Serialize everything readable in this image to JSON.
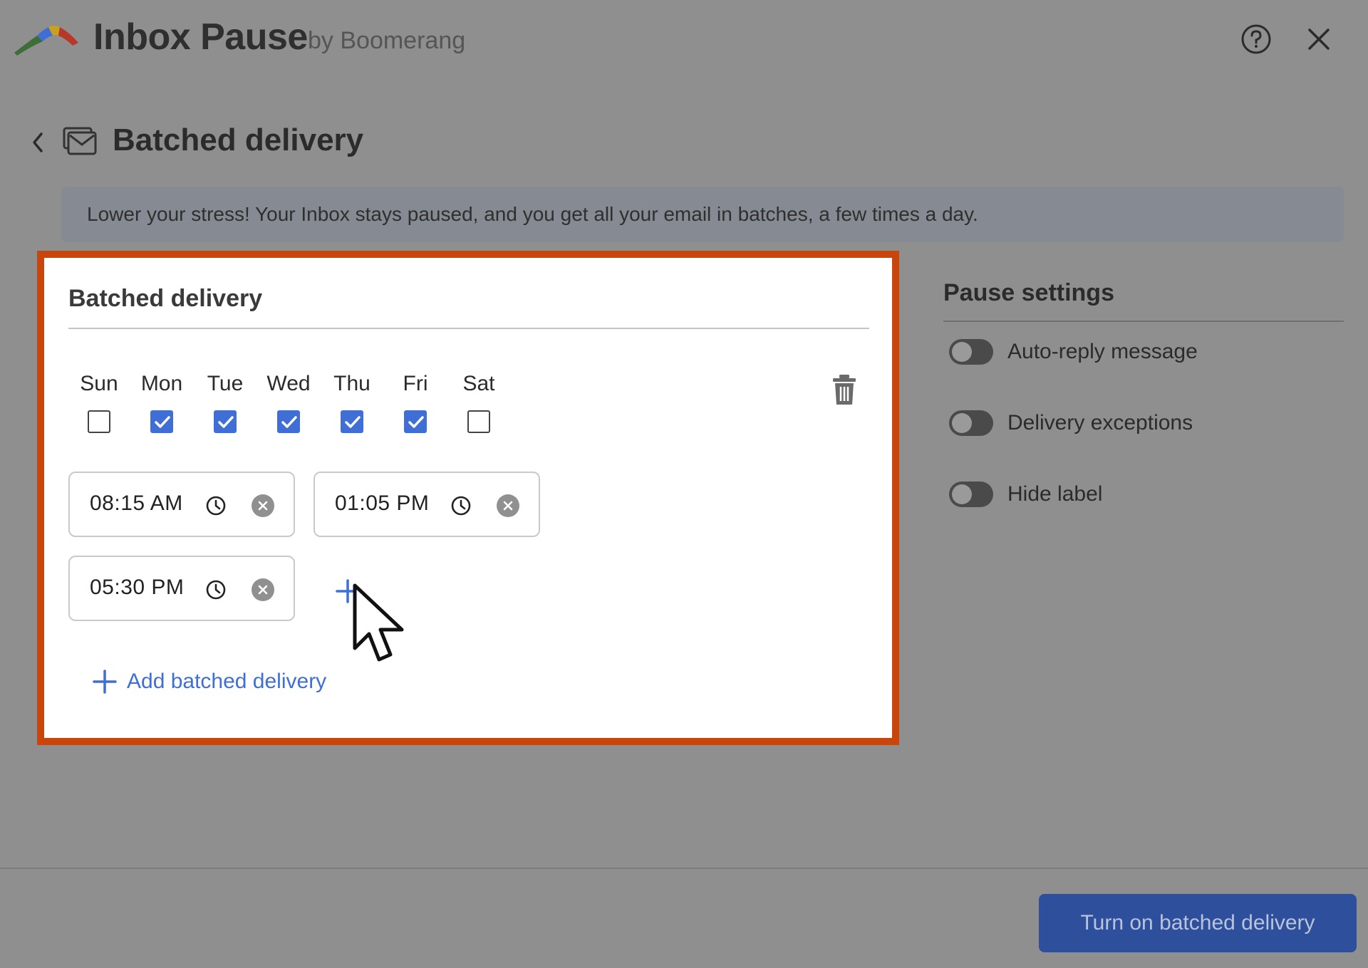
{
  "header": {
    "logo_icon": "boomerang-logo",
    "title": "Inbox Pause",
    "subtitle": "by Boomerang",
    "help_icon": "help-circle-icon",
    "close_icon": "close-icon"
  },
  "page": {
    "back_icon": "chevron-left-icon",
    "icon": "stacked-mail-icon",
    "title": "Batched delivery",
    "banner": "Lower your stress! Your Inbox stays paused, and you get all your email in batches, a few times a day."
  },
  "card": {
    "title": "Batched delivery",
    "days": [
      {
        "label": "Sun",
        "checked": false
      },
      {
        "label": "Mon",
        "checked": true
      },
      {
        "label": "Tue",
        "checked": true
      },
      {
        "label": "Wed",
        "checked": true
      },
      {
        "label": "Thu",
        "checked": true
      },
      {
        "label": "Fri",
        "checked": true
      },
      {
        "label": "Sat",
        "checked": false
      }
    ],
    "times": [
      "08:15 AM",
      "01:05 PM",
      "05:30 PM"
    ],
    "add_batch_label": "Add batched delivery"
  },
  "settings": {
    "title": "Pause settings",
    "items": [
      {
        "label": "Auto-reply message",
        "on": false
      },
      {
        "label": "Delivery exceptions",
        "on": false
      },
      {
        "label": "Hide label",
        "on": false
      }
    ]
  },
  "footer": {
    "primary_label": "Turn on batched delivery"
  },
  "colors": {
    "accent": "#3f6fd6",
    "highlight_border": "#c8450c",
    "primary_button": "#2e4f9c",
    "overlay": "#8f8f8f"
  }
}
